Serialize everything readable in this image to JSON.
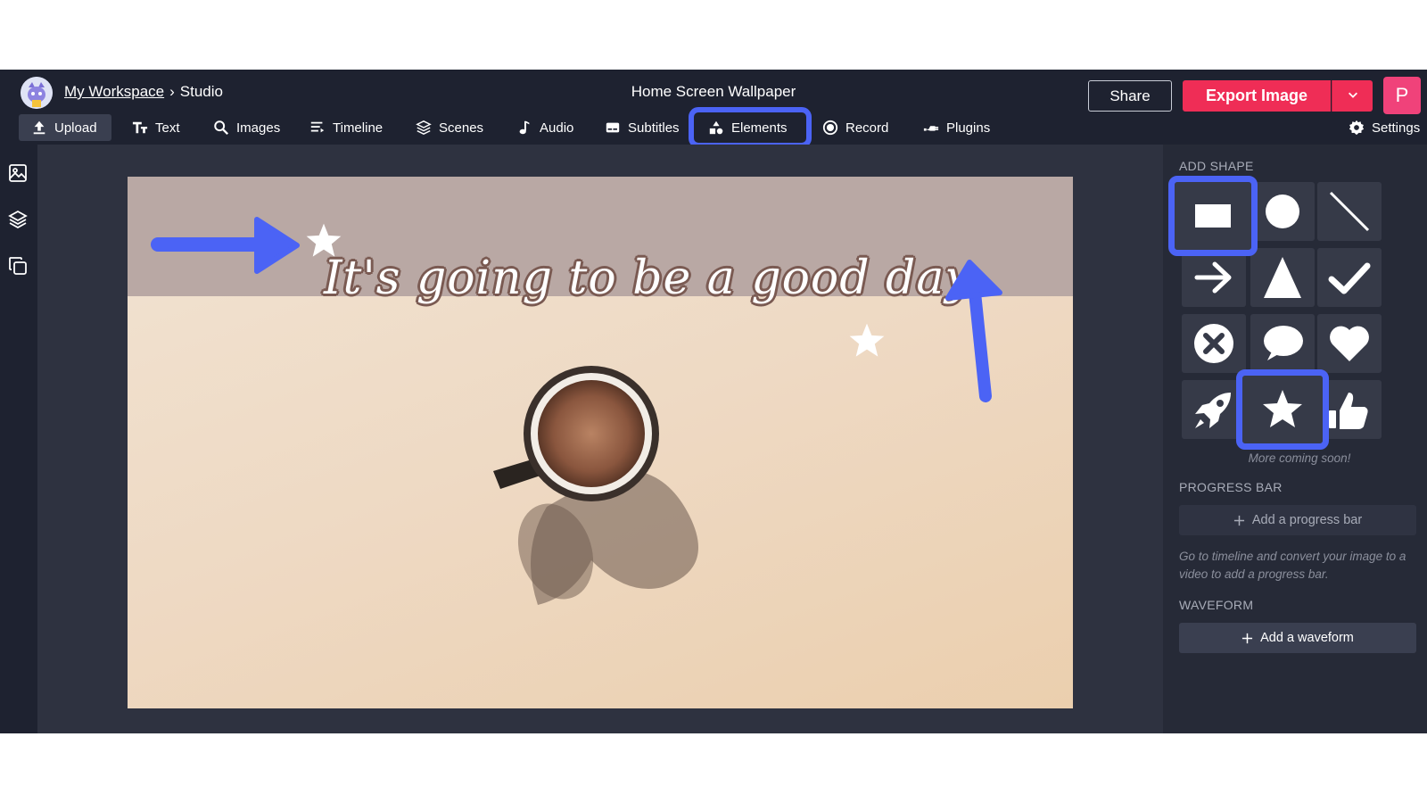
{
  "header": {
    "workspace_link": "My Workspace",
    "separator": "›",
    "section": "Studio",
    "project_title": "Home Screen Wallpaper",
    "share_label": "Share",
    "export_label": "Export Image",
    "user_initial": "P"
  },
  "toolbar": {
    "items": [
      {
        "label": "Upload",
        "icon": "upload-icon",
        "active": true
      },
      {
        "label": "Text",
        "icon": "text-icon"
      },
      {
        "label": "Images",
        "icon": "search-icon"
      },
      {
        "label": "Timeline",
        "icon": "timeline-icon"
      },
      {
        "label": "Scenes",
        "icon": "layers-icon"
      },
      {
        "label": "Audio",
        "icon": "music-note-icon"
      },
      {
        "label": "Subtitles",
        "icon": "subtitles-icon"
      },
      {
        "label": "Elements",
        "icon": "shapes-icon",
        "highlighted": true
      },
      {
        "label": "Record",
        "icon": "record-icon"
      },
      {
        "label": "Plugins",
        "icon": "plug-icon"
      }
    ],
    "settings_label": "Settings"
  },
  "left_rail": [
    "image-icon",
    "layers-icon",
    "copy-icon"
  ],
  "canvas": {
    "headline": "It's going to be a good day.",
    "band_color": "#b9a8a4",
    "background_color": "#eed9c3",
    "annotation_color": "#4b63f5"
  },
  "panel": {
    "add_shape_title": "ADD SHAPE",
    "shapes": [
      {
        "name": "rectangle",
        "highlighted": true
      },
      {
        "name": "circle"
      },
      {
        "name": "line"
      },
      {
        "name": "arrow"
      },
      {
        "name": "triangle"
      },
      {
        "name": "checkmark"
      },
      {
        "name": "x-circle"
      },
      {
        "name": "speech-bubble"
      },
      {
        "name": "heart"
      },
      {
        "name": "rocket"
      },
      {
        "name": "star",
        "highlighted": true
      },
      {
        "name": "thumbs-up"
      }
    ],
    "more_coming": "More coming soon!",
    "progress_title": "PROGRESS BAR",
    "progress_button": "Add a progress bar",
    "progress_note": "Go to timeline and convert your image to a video to add a progress bar.",
    "waveform_title": "WAVEFORM",
    "waveform_button": "Add a waveform"
  },
  "colors": {
    "app_bg": "#1e2230",
    "export_red": "#ef2d56",
    "avatar_pink": "#f0427a",
    "highlight_blue": "#4b63f5"
  }
}
